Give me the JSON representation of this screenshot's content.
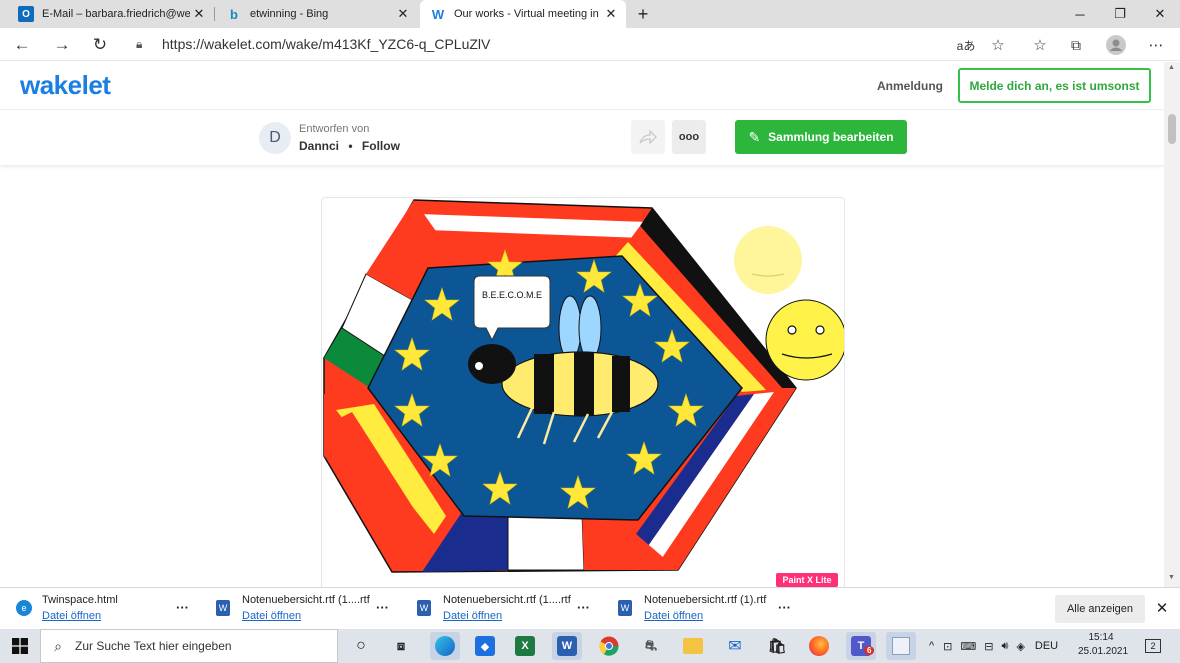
{
  "browser": {
    "tabs": [
      {
        "title": "E-Mail – barbara.friedrich@wein",
        "icon": "outlook-icon"
      },
      {
        "title": "etwinning - Bing",
        "icon": "bing-icon"
      },
      {
        "title": "Our works - Virtual meeting in C",
        "icon": "wakelet-icon",
        "active": true
      }
    ],
    "new_tab": "+",
    "url": "https://wakelet.com/wake/m413Kf_YZC6-q_CPLuZlV"
  },
  "wakelet": {
    "logo": "wakelet",
    "login": "Anmeldung",
    "signup": "Melde dich an, es ist umsonst",
    "designed_by": "Entworfen von",
    "avatar_letter": "D",
    "author": "Dannci",
    "follow": "Follow",
    "more": "ooo",
    "edit_collection": "Sammlung bearbeiten"
  },
  "artwork": {
    "speech": "B.E.E.C.O.M.E",
    "badge": "Paint X Lite"
  },
  "downloads": {
    "items": [
      {
        "name": "Twinspace.html",
        "action": "Datei öffnen",
        "icon": "edge-icon"
      },
      {
        "name": "Notenuebersicht.rtf (1....rtf",
        "action": "Datei öffnen",
        "icon": "word-icon"
      },
      {
        "name": "Notenuebersicht.rtf (1....rtf",
        "action": "Datei öffnen",
        "icon": "word-icon"
      },
      {
        "name": "Notenuebersicht.rtf (1).rtf",
        "action": "Datei öffnen",
        "icon": "word-icon"
      }
    ],
    "show_all": "Alle anzeigen"
  },
  "taskbar": {
    "search_placeholder": "Zur Suche Text hier eingeben",
    "language": "DEU",
    "time": "15:14",
    "date": "25.01.2021",
    "teams_badge": "6",
    "notif_count": "2"
  }
}
